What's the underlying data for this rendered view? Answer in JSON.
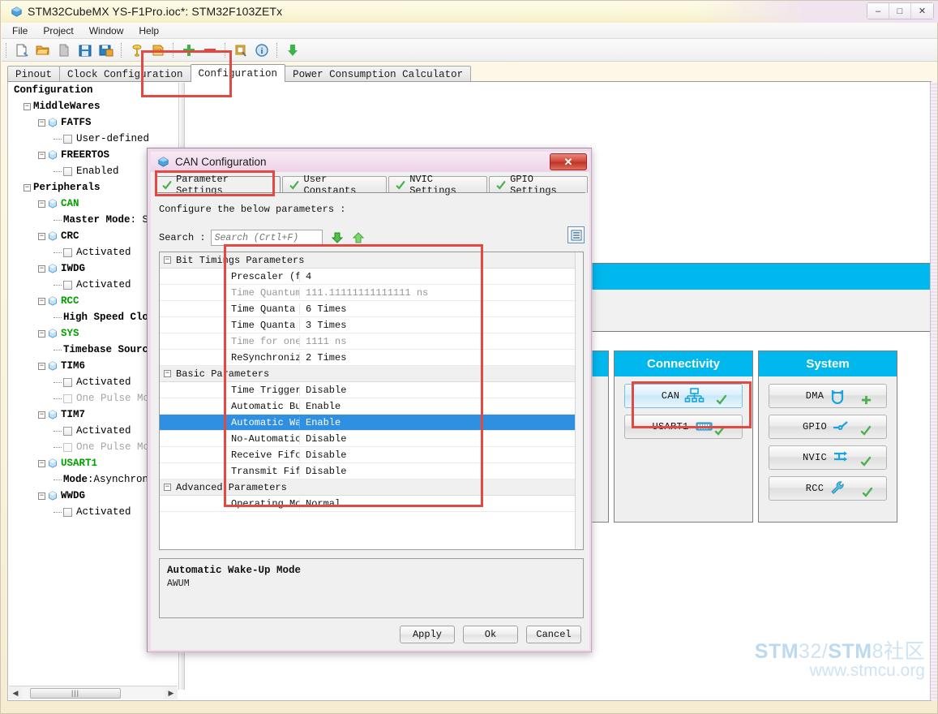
{
  "window": {
    "title": "STM32CubeMX YS-F1Pro.ioc*: STM32F103ZETx",
    "icon": "cube-icon",
    "buttons": {
      "minimize": "–",
      "maximize": "□",
      "close": "✕"
    }
  },
  "menubar": {
    "items": [
      "File",
      "Project",
      "Window",
      "Help"
    ]
  },
  "toolbar": {
    "icons": [
      "new-project-icon",
      "open-project-icon",
      "copy-icon",
      "save-icon",
      "save-as-icon",
      "generate-code-icon",
      "generate-report-icon",
      "zoom-in-icon",
      "zoom-out-icon",
      "find-icon",
      "about-icon",
      "download-icon"
    ]
  },
  "tabs": {
    "items": [
      "Pinout",
      "Clock Configuration",
      "Configuration",
      "Power Consumption Calculator"
    ],
    "active": "Configuration"
  },
  "sidebar": {
    "root": "Configuration",
    "groups": [
      {
        "label": "MiddleWares",
        "items": [
          {
            "label": "FATFS",
            "type": "peripheral",
            "state": "inactive",
            "children": [
              {
                "label": "User-defined",
                "type": "checkbox",
                "checked": false
              }
            ]
          },
          {
            "label": "FREERTOS",
            "type": "peripheral",
            "state": "inactive",
            "children": [
              {
                "label": "Enabled",
                "type": "checkbox",
                "checked": false
              }
            ]
          }
        ]
      },
      {
        "label": "Peripherals",
        "items": [
          {
            "label": "CAN",
            "type": "peripheral",
            "state": "active",
            "children": [
              {
                "label": "Master Mode",
                "value": "Set",
                "type": "value"
              }
            ]
          },
          {
            "label": "CRC",
            "type": "peripheral",
            "state": "inactive",
            "children": [
              {
                "label": "Activated",
                "type": "checkbox",
                "checked": false
              }
            ]
          },
          {
            "label": "IWDG",
            "type": "peripheral",
            "state": "inactive",
            "children": [
              {
                "label": "Activated",
                "type": "checkbox",
                "checked": false
              }
            ]
          },
          {
            "label": "RCC",
            "type": "peripheral",
            "state": "active",
            "children": [
              {
                "label": "High Speed Clock",
                "value": "",
                "type": "value"
              }
            ]
          },
          {
            "label": "SYS",
            "type": "peripheral",
            "state": "active",
            "children": [
              {
                "label": "Timebase Source",
                "value": "",
                "type": "value"
              }
            ]
          },
          {
            "label": "TIM6",
            "type": "peripheral",
            "state": "inactive",
            "children": [
              {
                "label": "Activated",
                "type": "checkbox",
                "checked": false
              },
              {
                "label": "One Pulse Mode",
                "type": "checkbox",
                "checked": false,
                "disabled": true
              }
            ]
          },
          {
            "label": "TIM7",
            "type": "peripheral",
            "state": "inactive",
            "children": [
              {
                "label": "Activated",
                "type": "checkbox",
                "checked": false
              },
              {
                "label": "One Pulse Mode",
                "type": "checkbox",
                "checked": false,
                "disabled": true
              }
            ]
          },
          {
            "label": "USART1",
            "type": "peripheral",
            "state": "active",
            "children": [
              {
                "label": "Mode",
                "value": "Asynchronous",
                "type": "value"
              }
            ]
          },
          {
            "label": "WWDG",
            "type": "peripheral",
            "state": "inactive",
            "children": [
              {
                "label": "Activated",
                "type": "checkbox",
                "checked": false
              }
            ]
          }
        ]
      }
    ],
    "scrollbar": {
      "left_arrow": "◀",
      "right_arrow": "▶",
      "grip": "‖‖"
    }
  },
  "canvas": {
    "groups": [
      {
        "title": "",
        "items": []
      },
      {
        "title": "Connectivity",
        "items": [
          {
            "label": "CAN",
            "icon": "network-icon",
            "selected": true,
            "configured": true
          },
          {
            "label": "USART1",
            "icon": "serial-icon",
            "selected": false,
            "configured": true
          }
        ]
      },
      {
        "title": "System",
        "items": [
          {
            "label": "DMA",
            "icon": "dma-icon",
            "selected": false,
            "configured": false
          },
          {
            "label": "GPIO",
            "icon": "gpio-icon",
            "selected": false,
            "configured": true
          },
          {
            "label": "NVIC",
            "icon": "nvic-icon",
            "selected": false,
            "configured": true
          },
          {
            "label": "RCC",
            "icon": "wrench-icon",
            "selected": false,
            "configured": true
          }
        ]
      }
    ]
  },
  "dialog": {
    "title": "CAN Configuration",
    "icon": "cube-icon",
    "close_label": "✕",
    "tabs": [
      {
        "label": "Parameter Settings",
        "active": true,
        "icon": "check-icon"
      },
      {
        "label": "User Constants",
        "active": false,
        "icon": "check-icon"
      },
      {
        "label": "NVIC Settings",
        "active": false,
        "icon": "check-icon"
      },
      {
        "label": "GPIO Settings",
        "active": false,
        "icon": "check-icon"
      }
    ],
    "note": "Configure the below parameters :",
    "search": {
      "label": "Search :",
      "value": "",
      "placeholder": "Search (Crtl+F)",
      "next_icon": "arrow-down-icon",
      "prev_icon": "arrow-up-icon"
    },
    "list_toggle_icon": "list-view-icon",
    "sections": [
      {
        "title": "Bit Timings Parameters",
        "rows": [
          {
            "name": "Prescaler (for Time Quan...",
            "value": "4",
            "readonly": false,
            "selected": false
          },
          {
            "name": "Time Quantum",
            "value": "111.11111111111111 ns",
            "readonly": true,
            "selected": false
          },
          {
            "name": "Time Quanta in Bit Segme...",
            "value": "6 Times",
            "readonly": false,
            "selected": false
          },
          {
            "name": "Time Quanta in Bit Segme...",
            "value": "3 Times",
            "readonly": false,
            "selected": false
          },
          {
            "name": "Time for one Bit",
            "value": "1111 ns",
            "readonly": true,
            "selected": false
          },
          {
            "name": "ReSynchronization Jump W...",
            "value": "2 Times",
            "readonly": false,
            "selected": false
          }
        ]
      },
      {
        "title": "Basic Parameters",
        "rows": [
          {
            "name": "Time Triggered Communica...",
            "value": "Disable",
            "readonly": false,
            "selected": false
          },
          {
            "name": "Automatic Bus-Off Manage...",
            "value": "Enable",
            "readonly": false,
            "selected": false
          },
          {
            "name": "Automatic Wake-Up Mode",
            "value": "Enable",
            "readonly": false,
            "selected": true
          },
          {
            "name": "No-Automatic Retransmission",
            "value": "Disable",
            "readonly": false,
            "selected": false
          },
          {
            "name": "Receive Fifo Locked Mode",
            "value": "Disable",
            "readonly": false,
            "selected": false
          },
          {
            "name": "Transmit Fifo Priority",
            "value": "Disable",
            "readonly": false,
            "selected": false
          }
        ]
      },
      {
        "title": "Advanced Parameters",
        "rows": [
          {
            "name": "Operating Mode",
            "value": "Normal",
            "readonly": false,
            "selected": false
          }
        ]
      }
    ],
    "description": {
      "title": "Automatic Wake-Up Mode",
      "body": "AWUM"
    },
    "buttons": [
      "Apply",
      "Ok",
      "Cancel"
    ]
  },
  "watermark": {
    "line1_a": "STM",
    "line1_b": "32/",
    "line1_c": "STM",
    "line1_d": "8社区",
    "line2": "www.stmcu.org"
  },
  "colors": {
    "accent_cyan": "#00b7ee",
    "selection_blue": "#2f8fe0",
    "annotation_red": "#e04a43",
    "active_green": "#00a000",
    "title_yellow": "#fbf4dd"
  }
}
